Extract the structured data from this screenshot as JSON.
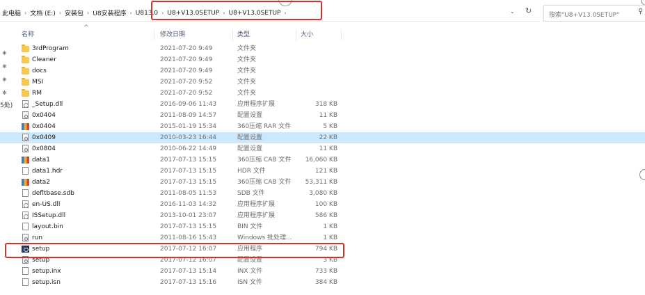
{
  "address": {
    "crumbs": [
      "此电脑",
      "文档 (E:)",
      "安装包",
      "U8安装程序",
      "U813.0",
      "U8+V13.0SETUP",
      "U8+V13.0SETUP"
    ]
  },
  "search": {
    "placeholder": "搜索\"U8+V13.0SETUP\""
  },
  "nav": {
    "fragment": "5处)"
  },
  "columns": {
    "name": "名称",
    "date": "修改日期",
    "type": "类型",
    "size": "大小"
  },
  "files": [
    {
      "name": "3rdProgram",
      "date": "2021-07-20 9:49",
      "type": "文件夹",
      "size": "",
      "icon": "folder-icon"
    },
    {
      "name": "Cleaner",
      "date": "2021-07-20 9:49",
      "type": "文件夹",
      "size": "",
      "icon": "folder-icon"
    },
    {
      "name": "docs",
      "date": "2021-07-20 9:49",
      "type": "文件夹",
      "size": "",
      "icon": "folder-icon"
    },
    {
      "name": "MSI",
      "date": "2021-07-20 9:52",
      "type": "文件夹",
      "size": "",
      "icon": "folder-icon"
    },
    {
      "name": "RM",
      "date": "2021-07-20 9:52",
      "type": "文件夹",
      "size": "",
      "icon": "folder-icon"
    },
    {
      "name": "_Setup.dll",
      "date": "2016-09-06 11:43",
      "type": "应用程序扩展",
      "size": "318 KB",
      "icon": "dll-icon"
    },
    {
      "name": "0x0404",
      "date": "2011-08-09 14:57",
      "type": "配置设置",
      "size": "11 KB",
      "icon": "config-icon"
    },
    {
      "name": "0x0404",
      "date": "2015-01-19 15:34",
      "type": "360压缩 RAR 文件",
      "size": "5 KB",
      "icon": "archive-icon"
    },
    {
      "name": "0x0409",
      "date": "2010-03-23 16:44",
      "type": "配置设置",
      "size": "22 KB",
      "icon": "config-icon"
    },
    {
      "name": "0x0804",
      "date": "2010-06-22 14:49",
      "type": "配置设置",
      "size": "11 KB",
      "icon": "config-icon"
    },
    {
      "name": "data1",
      "date": "2017-07-13 15:15",
      "type": "360压缩 CAB 文件",
      "size": "16,060 KB",
      "icon": "archive-icon"
    },
    {
      "name": "data1.hdr",
      "date": "2017-07-13 15:15",
      "type": "HDR 文件",
      "size": "121 KB",
      "icon": "file-icon"
    },
    {
      "name": "data2",
      "date": "2017-07-13 15:15",
      "type": "360压缩 CAB 文件",
      "size": "53,311 KB",
      "icon": "archive-icon"
    },
    {
      "name": "defltbase.sdb",
      "date": "2011-08-05 11:53",
      "type": "SDB 文件",
      "size": "3,080 KB",
      "icon": "file-icon"
    },
    {
      "name": "en-US.dll",
      "date": "2016-11-03 14:32",
      "type": "应用程序扩展",
      "size": "100 KB",
      "icon": "dll-icon"
    },
    {
      "name": "ISSetup.dll",
      "date": "2013-10-01 23:07",
      "type": "应用程序扩展",
      "size": "586 KB",
      "icon": "dll-icon"
    },
    {
      "name": "layout.bin",
      "date": "2017-07-13 15:15",
      "type": "BIN 文件",
      "size": "1 KB",
      "icon": "file-icon"
    },
    {
      "name": "run",
      "date": "2011-08-16 15:43",
      "type": "Windows 批处理...",
      "size": "1 KB",
      "icon": "batch-icon"
    },
    {
      "name": "setup",
      "date": "2017-07-12 16:07",
      "type": "应用程序",
      "size": "794 KB",
      "icon": "setup-exe-icon"
    },
    {
      "name": "setup",
      "date": "2017-07-12 16:07",
      "type": "配置设置",
      "size": "3 KB",
      "icon": "config-icon"
    },
    {
      "name": "setup.inx",
      "date": "2017-07-13 15:14",
      "type": "INX 文件",
      "size": "733 KB",
      "icon": "file-icon"
    },
    {
      "name": "setup.isn",
      "date": "2017-07-13 15:16",
      "type": "ISN 文件",
      "size": "384 KB",
      "icon": "file-icon"
    }
  ],
  "selected_index": 8,
  "highlight_color": "#d6312b"
}
